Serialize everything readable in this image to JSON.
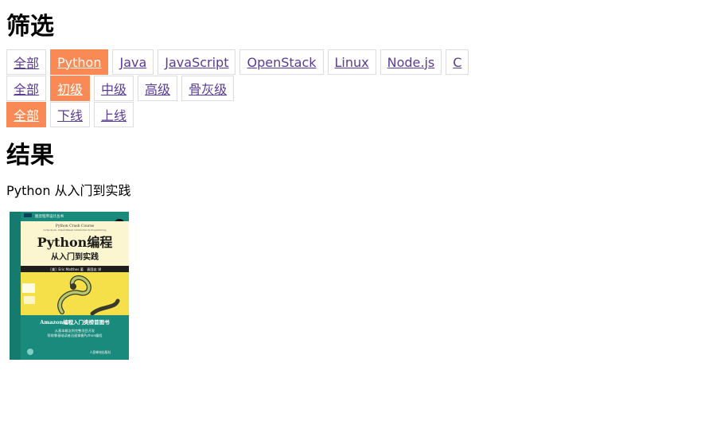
{
  "filter_heading": "筛选",
  "filters": {
    "language": {
      "options": [
        "全部",
        "Python",
        "Java",
        "JavaScript",
        "OpenStack",
        "Linux",
        "Node.js",
        "C"
      ],
      "selected": "Python"
    },
    "level": {
      "options": [
        "全部",
        "初级",
        "中级",
        "高级",
        "骨灰级"
      ],
      "selected": "初级"
    },
    "status": {
      "options": [
        "全部",
        "下线",
        "上线"
      ],
      "selected": "全部"
    }
  },
  "results_heading": "结果",
  "results": [
    {
      "title": "Python 从入门到实践",
      "cover": {
        "series": "图灵程序设计丛书",
        "english_title": "Python Crash Course",
        "english_subtitle": "A Hands-On, Project-Based Introduction to Programming",
        "main_title": "Python编程",
        "sub_title": "从入门到实践",
        "authors": "［美］Eric Matthes 著　袁国忠 译",
        "banner": "Amazon编程入门类榜首图书",
        "blurb_line1": "从基本概念到完整项目开发",
        "blurb_line2": "帮助零基础读者迅速掌握Python编程",
        "publisher": "人民邮电出版社",
        "colors": {
          "teal": "#1a8a7c",
          "cream": "#fbf6cf",
          "yellow": "#f5e04a"
        }
      }
    }
  ]
}
